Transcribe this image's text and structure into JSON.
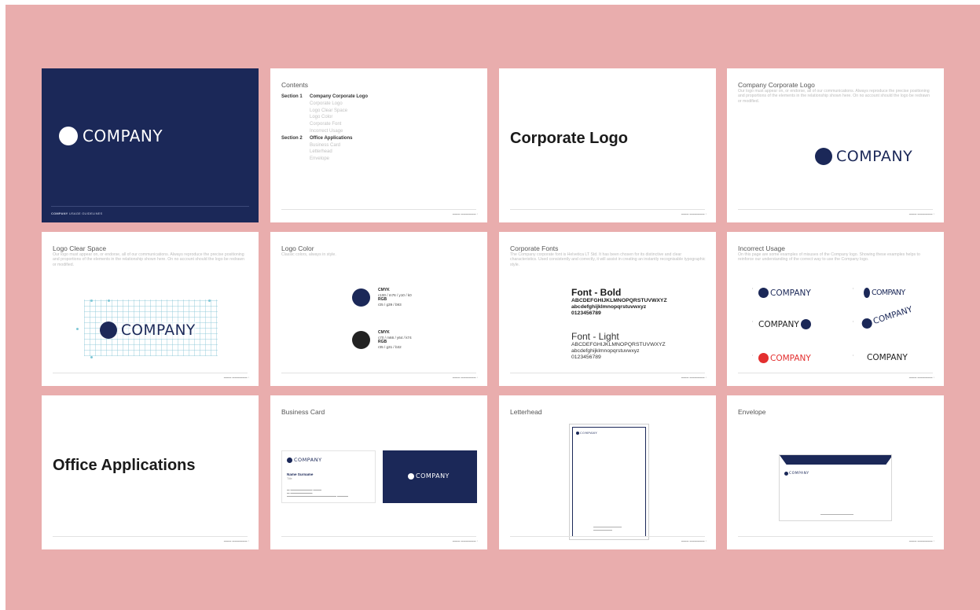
{
  "brand": {
    "navy": "#1b2858",
    "red": "#e32f2f",
    "black": "#222222",
    "background": "#e9adad"
  },
  "cover": {
    "logo": "COMPANY",
    "footer_bold": "COMPANY",
    "footer_rest": "USAGE GUIDELINES"
  },
  "contents": {
    "title": "Contents",
    "sections": [
      {
        "label": "Section 1",
        "name": "Company Corporate Logo",
        "items": [
          "Corporate Logo",
          "Logo Clear Space",
          "Logo Color",
          "Corporate Font",
          "Incorrect Usage"
        ]
      },
      {
        "label": "Section 2",
        "name": "Office Applications",
        "items": [
          "Business Card",
          "Letterhead",
          "Envelope"
        ]
      }
    ]
  },
  "corporate_logo_divider": {
    "title": "Corporate Logo"
  },
  "company_logo": {
    "title": "Company Corporate Logo",
    "desc": "Our logo must appear on, or endorse, all of our communications. Always reproduce the precise positioning and proportions of the elements in the relationship shown here. On no account should the logo be redrawn or modified.",
    "logo": "COMPANY"
  },
  "clear_space": {
    "title": "Logo Clear Space",
    "desc": "Our logo must appear on, or endorse, all of our communications. Always reproduce the precise positioning and proportions of the elements in the relationship shown here. On no account should the logo be redrawn or modified.",
    "logo": "COMPANY"
  },
  "logo_color": {
    "title": "Logo Color",
    "desc": "Classic colors, always in style.",
    "swatches": [
      {
        "cmyk_label": "CMYK",
        "cmyk": "c100 / m76 / y10 / k0",
        "rgb_label": "RGB",
        "rgb": "r25 / g39 / b93"
      },
      {
        "cmyk_label": "CMYK",
        "cmyk": "c70 / m66 / y64 / k74",
        "rgb_label": "RGB",
        "rgb": "r35 / g31 / b32"
      }
    ]
  },
  "fonts": {
    "title": "Corporate Fonts",
    "desc": "The Company corporate font is Helvetica LT Std. It has been chosen for its distinctive and clear characteristics. Used consistently and correctly, it will assist in creating an instantly recognisable typographic style.",
    "bold_heading": "Font - Bold",
    "light_heading": "Font - Light",
    "upper": "ABCDEFGHIJKLMNOPQRSTUVWXYZ",
    "lower": "abcdefghijklmnopqrstuvwxyz",
    "digits": "0123456789"
  },
  "incorrect": {
    "title": "Incorrect Usage",
    "desc": "On this page are some examples of misuses of the Company logo. Showing these examples helps to reinforce our understanding of the correct way to use the Company logo.",
    "logo": "COMPANY"
  },
  "office_divider": {
    "title": "Office Applications"
  },
  "business_card": {
    "title": "Business Card",
    "logo": "COMPANY",
    "name": "Name Surname",
    "role": "Title"
  },
  "letterhead": {
    "title": "Letterhead",
    "logo": "COMPANY"
  },
  "envelope": {
    "title": "Envelope",
    "logo": "COMPANY"
  }
}
